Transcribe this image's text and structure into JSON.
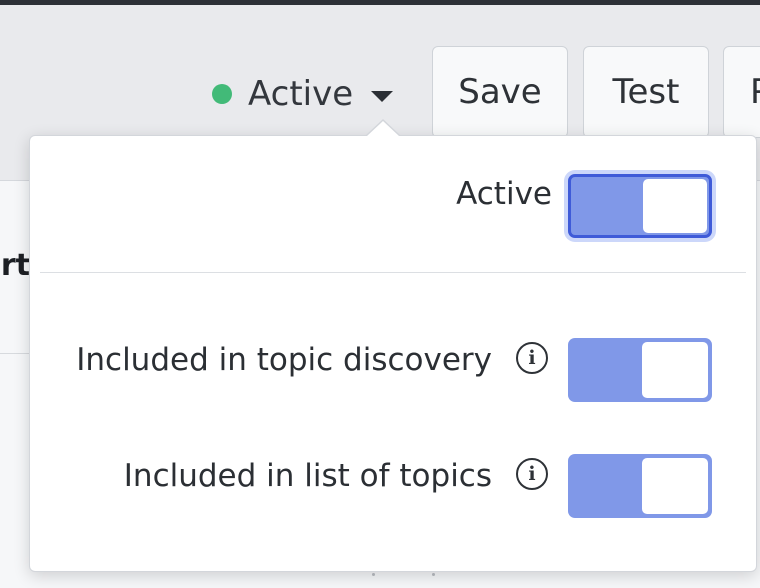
{
  "header": {
    "status_label": "Active",
    "status_color": "#42ba78",
    "buttons": {
      "save": "Save",
      "test": "Test",
      "more": "P"
    }
  },
  "background": {
    "fragment_text": "rt",
    "side_mark": "/"
  },
  "popover": {
    "active": {
      "label": "Active",
      "on": true
    },
    "topic_discovery": {
      "label": "Included in topic discovery",
      "info_icon": "i",
      "on": true
    },
    "list_of_topics": {
      "label": "Included in list of topics",
      "info_icon": "i",
      "on": true
    }
  },
  "colors": {
    "toggle_track": "#8098e8",
    "toggle_focus": "#3f5bd8"
  }
}
